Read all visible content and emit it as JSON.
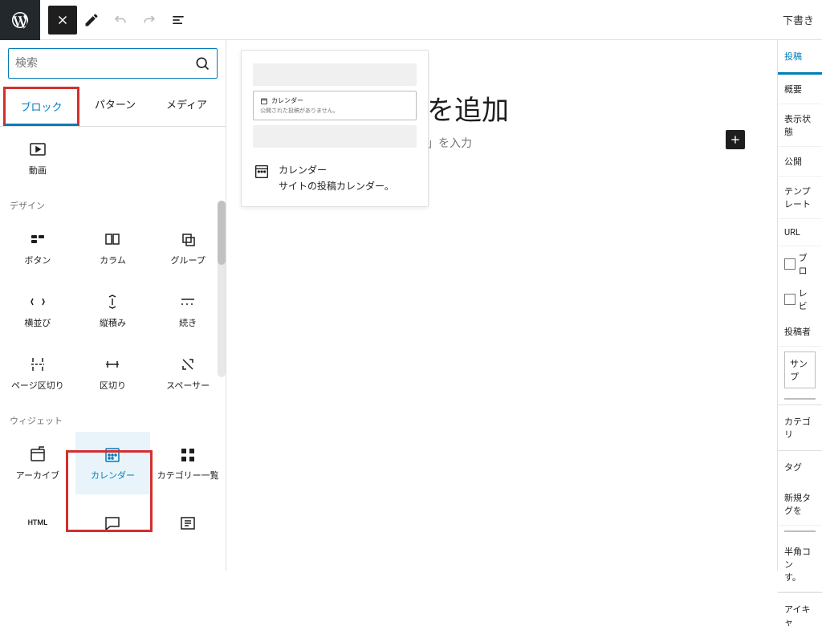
{
  "toolbar": {
    "draft_label": "下書き"
  },
  "inserter": {
    "search_placeholder": "検索",
    "tabs": {
      "block": "ブロック",
      "pattern": "パターン",
      "media": "メディア"
    },
    "block_video": "動画",
    "cat_design": "デザイン",
    "blk_button": "ボタン",
    "blk_column": "カラム",
    "blk_group": "グループ",
    "blk_row": "横並び",
    "blk_stack": "縦積み",
    "blk_more": "続き",
    "blk_pagebreak": "ページ区切り",
    "blk_separator": "区切り",
    "blk_spacer": "スペーサー",
    "cat_widget": "ウィジェット",
    "blk_archive": "アーカイブ",
    "blk_calendar": "カレンダー",
    "blk_catlist": "カテゴリー一覧",
    "blk_html": "HTML"
  },
  "preview": {
    "cal_title": "カレンダー",
    "cal_msg": "公開された投稿がありません。",
    "desc_title": "カレンダー",
    "desc_body": "サイトの投稿カレンダー。"
  },
  "canvas": {
    "title_tail": "を追加",
    "subtitle_tail": "」を入力"
  },
  "sidebar": {
    "tab_post": "投稿",
    "summary": "概要",
    "visibility": "表示状態",
    "publish": "公開",
    "template": "テンプレート",
    "url": "URL",
    "chk1": "ブロ",
    "chk2": "レビ",
    "author": "投稿者",
    "author_value": "サンプ",
    "category": "カテゴリ",
    "tag": "タグ",
    "newtag": "新規タグを",
    "half": "半角コン",
    "su": "す。",
    "featured": "アイキャ"
  }
}
